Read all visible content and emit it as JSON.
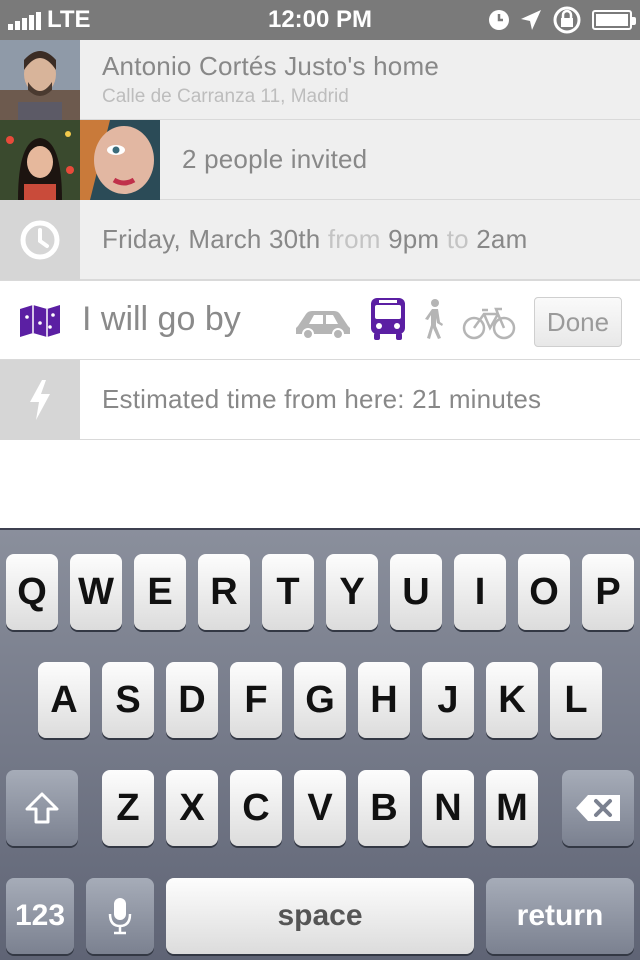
{
  "status_bar": {
    "carrier": "LTE",
    "time": "12:00 PM"
  },
  "event": {
    "location_title": "Antonio Cortés Justo's home",
    "location_address": "Calle de Carranza 11, Madrid",
    "invited": "2 people invited",
    "date": "Friday, March 30th",
    "from_word": "from",
    "start_time": "9pm",
    "to_word": "to",
    "end_time": "2am"
  },
  "transport": {
    "label": "I will go by",
    "options": [
      "car",
      "bus",
      "walk",
      "bike"
    ],
    "selected": "bus",
    "done_label": "Done"
  },
  "estimate": {
    "text": "Estimated time from here: 21 minutes"
  },
  "keyboard": {
    "row1": [
      "Q",
      "W",
      "E",
      "R",
      "T",
      "Y",
      "U",
      "I",
      "O",
      "P"
    ],
    "row2": [
      "A",
      "S",
      "D",
      "F",
      "G",
      "H",
      "J",
      "K",
      "L"
    ],
    "row3": [
      "Z",
      "X",
      "C",
      "V",
      "B",
      "N",
      "M"
    ],
    "numbers_label": "123",
    "space_label": "space",
    "return_label": "return"
  },
  "colors": {
    "accent": "#5b1fa3",
    "icon_gray": "#b5b5b5"
  }
}
